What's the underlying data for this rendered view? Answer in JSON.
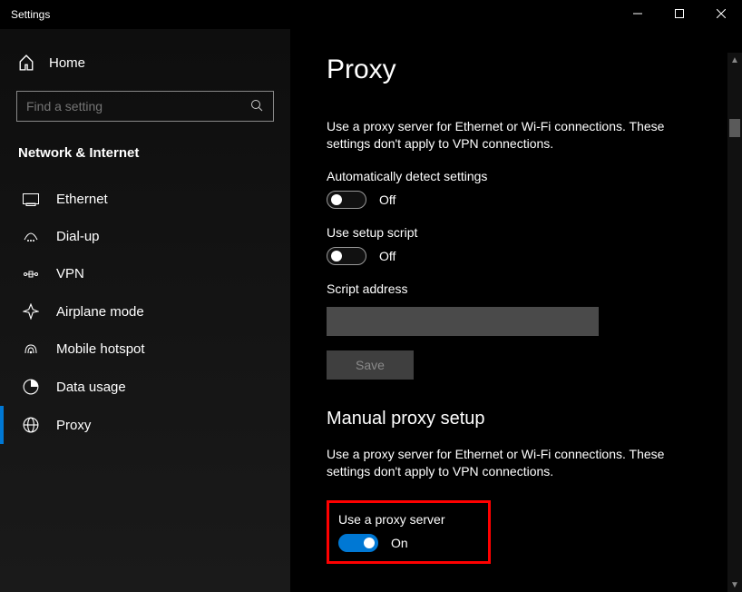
{
  "titlebar": {
    "title": "Settings"
  },
  "sidebar": {
    "home_label": "Home",
    "search_placeholder": "Find a setting",
    "category_header": "Network & Internet",
    "items": [
      {
        "label": "Ethernet"
      },
      {
        "label": "Dial-up"
      },
      {
        "label": "VPN"
      },
      {
        "label": "Airplane mode"
      },
      {
        "label": "Mobile hotspot"
      },
      {
        "label": "Data usage"
      },
      {
        "label": "Proxy"
      }
    ]
  },
  "content": {
    "page_title": "Proxy",
    "auto_desc": "Use a proxy server for Ethernet or Wi-Fi connections. These settings don't apply to VPN connections.",
    "auto_detect_label": "Automatically detect settings",
    "auto_detect_state": "Off",
    "setup_script_label": "Use setup script",
    "setup_script_state": "Off",
    "script_address_label": "Script address",
    "script_address_value": "",
    "save_label": "Save",
    "manual_header": "Manual proxy setup",
    "manual_desc": "Use a proxy server for Ethernet or Wi-Fi connections. These settings don't apply to VPN connections.",
    "use_proxy_label": "Use a proxy server",
    "use_proxy_state": "On"
  }
}
